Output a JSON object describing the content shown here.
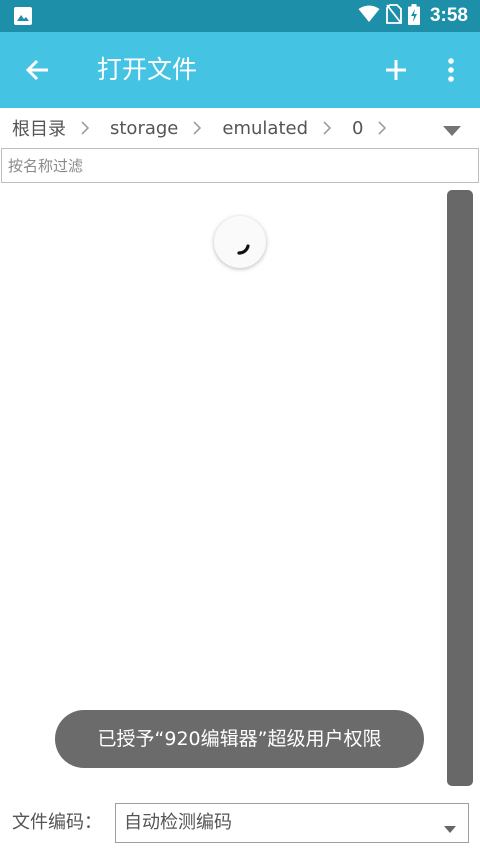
{
  "status_bar": {
    "time": "3:58",
    "icons": [
      "gallery-icon",
      "wifi-icon",
      "no-sim-icon",
      "battery-charging-icon"
    ]
  },
  "app_bar": {
    "title": "打开文件",
    "icons": [
      "back-arrow-icon",
      "add-icon",
      "more-vert-icon"
    ]
  },
  "breadcrumb": {
    "items": [
      "根目录",
      "storage",
      "emulated",
      "0"
    ],
    "separator_icon": "chevron-right-icon",
    "dropdown_icon": "caret-down-icon"
  },
  "filter": {
    "placeholder": "按名称过滤",
    "value": ""
  },
  "loading": {
    "icon": "loading-spinner-icon"
  },
  "toast": {
    "message": "已授予“920编辑器”超级用户权限"
  },
  "encoding": {
    "label": "文件编码：",
    "selected": "自动检测编码",
    "dropdown_icon": "caret-down-icon"
  },
  "colors": {
    "status_bar": "#1e8fa8",
    "app_bar": "#45c3e3",
    "toast": "#6b6b6b",
    "scrollbar": "#686868"
  }
}
